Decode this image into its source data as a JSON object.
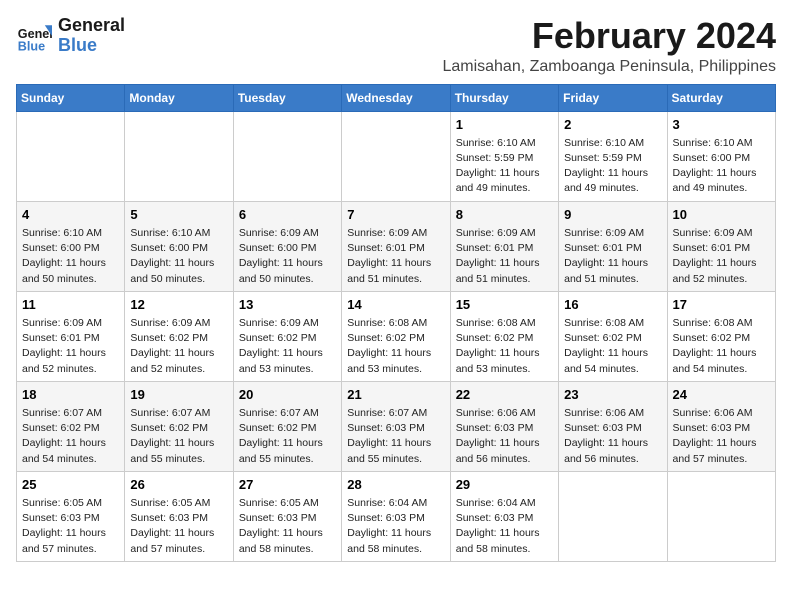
{
  "header": {
    "logo_line1": "General",
    "logo_line2": "Blue",
    "month": "February 2024",
    "location": "Lamisahan, Zamboanga Peninsula, Philippines"
  },
  "weekdays": [
    "Sunday",
    "Monday",
    "Tuesday",
    "Wednesday",
    "Thursday",
    "Friday",
    "Saturday"
  ],
  "weeks": [
    [
      {
        "day": "",
        "info": ""
      },
      {
        "day": "",
        "info": ""
      },
      {
        "day": "",
        "info": ""
      },
      {
        "day": "",
        "info": ""
      },
      {
        "day": "1",
        "info": "Sunrise: 6:10 AM\nSunset: 5:59 PM\nDaylight: 11 hours\nand 49 minutes."
      },
      {
        "day": "2",
        "info": "Sunrise: 6:10 AM\nSunset: 5:59 PM\nDaylight: 11 hours\nand 49 minutes."
      },
      {
        "day": "3",
        "info": "Sunrise: 6:10 AM\nSunset: 6:00 PM\nDaylight: 11 hours\nand 49 minutes."
      }
    ],
    [
      {
        "day": "4",
        "info": "Sunrise: 6:10 AM\nSunset: 6:00 PM\nDaylight: 11 hours\nand 50 minutes."
      },
      {
        "day": "5",
        "info": "Sunrise: 6:10 AM\nSunset: 6:00 PM\nDaylight: 11 hours\nand 50 minutes."
      },
      {
        "day": "6",
        "info": "Sunrise: 6:09 AM\nSunset: 6:00 PM\nDaylight: 11 hours\nand 50 minutes."
      },
      {
        "day": "7",
        "info": "Sunrise: 6:09 AM\nSunset: 6:01 PM\nDaylight: 11 hours\nand 51 minutes."
      },
      {
        "day": "8",
        "info": "Sunrise: 6:09 AM\nSunset: 6:01 PM\nDaylight: 11 hours\nand 51 minutes."
      },
      {
        "day": "9",
        "info": "Sunrise: 6:09 AM\nSunset: 6:01 PM\nDaylight: 11 hours\nand 51 minutes."
      },
      {
        "day": "10",
        "info": "Sunrise: 6:09 AM\nSunset: 6:01 PM\nDaylight: 11 hours\nand 52 minutes."
      }
    ],
    [
      {
        "day": "11",
        "info": "Sunrise: 6:09 AM\nSunset: 6:01 PM\nDaylight: 11 hours\nand 52 minutes."
      },
      {
        "day": "12",
        "info": "Sunrise: 6:09 AM\nSunset: 6:02 PM\nDaylight: 11 hours\nand 52 minutes."
      },
      {
        "day": "13",
        "info": "Sunrise: 6:09 AM\nSunset: 6:02 PM\nDaylight: 11 hours\nand 53 minutes."
      },
      {
        "day": "14",
        "info": "Sunrise: 6:08 AM\nSunset: 6:02 PM\nDaylight: 11 hours\nand 53 minutes."
      },
      {
        "day": "15",
        "info": "Sunrise: 6:08 AM\nSunset: 6:02 PM\nDaylight: 11 hours\nand 53 minutes."
      },
      {
        "day": "16",
        "info": "Sunrise: 6:08 AM\nSunset: 6:02 PM\nDaylight: 11 hours\nand 54 minutes."
      },
      {
        "day": "17",
        "info": "Sunrise: 6:08 AM\nSunset: 6:02 PM\nDaylight: 11 hours\nand 54 minutes."
      }
    ],
    [
      {
        "day": "18",
        "info": "Sunrise: 6:07 AM\nSunset: 6:02 PM\nDaylight: 11 hours\nand 54 minutes."
      },
      {
        "day": "19",
        "info": "Sunrise: 6:07 AM\nSunset: 6:02 PM\nDaylight: 11 hours\nand 55 minutes."
      },
      {
        "day": "20",
        "info": "Sunrise: 6:07 AM\nSunset: 6:02 PM\nDaylight: 11 hours\nand 55 minutes."
      },
      {
        "day": "21",
        "info": "Sunrise: 6:07 AM\nSunset: 6:03 PM\nDaylight: 11 hours\nand 55 minutes."
      },
      {
        "day": "22",
        "info": "Sunrise: 6:06 AM\nSunset: 6:03 PM\nDaylight: 11 hours\nand 56 minutes."
      },
      {
        "day": "23",
        "info": "Sunrise: 6:06 AM\nSunset: 6:03 PM\nDaylight: 11 hours\nand 56 minutes."
      },
      {
        "day": "24",
        "info": "Sunrise: 6:06 AM\nSunset: 6:03 PM\nDaylight: 11 hours\nand 57 minutes."
      }
    ],
    [
      {
        "day": "25",
        "info": "Sunrise: 6:05 AM\nSunset: 6:03 PM\nDaylight: 11 hours\nand 57 minutes."
      },
      {
        "day": "26",
        "info": "Sunrise: 6:05 AM\nSunset: 6:03 PM\nDaylight: 11 hours\nand 57 minutes."
      },
      {
        "day": "27",
        "info": "Sunrise: 6:05 AM\nSunset: 6:03 PM\nDaylight: 11 hours\nand 58 minutes."
      },
      {
        "day": "28",
        "info": "Sunrise: 6:04 AM\nSunset: 6:03 PM\nDaylight: 11 hours\nand 58 minutes."
      },
      {
        "day": "29",
        "info": "Sunrise: 6:04 AM\nSunset: 6:03 PM\nDaylight: 11 hours\nand 58 minutes."
      },
      {
        "day": "",
        "info": ""
      },
      {
        "day": "",
        "info": ""
      }
    ]
  ]
}
